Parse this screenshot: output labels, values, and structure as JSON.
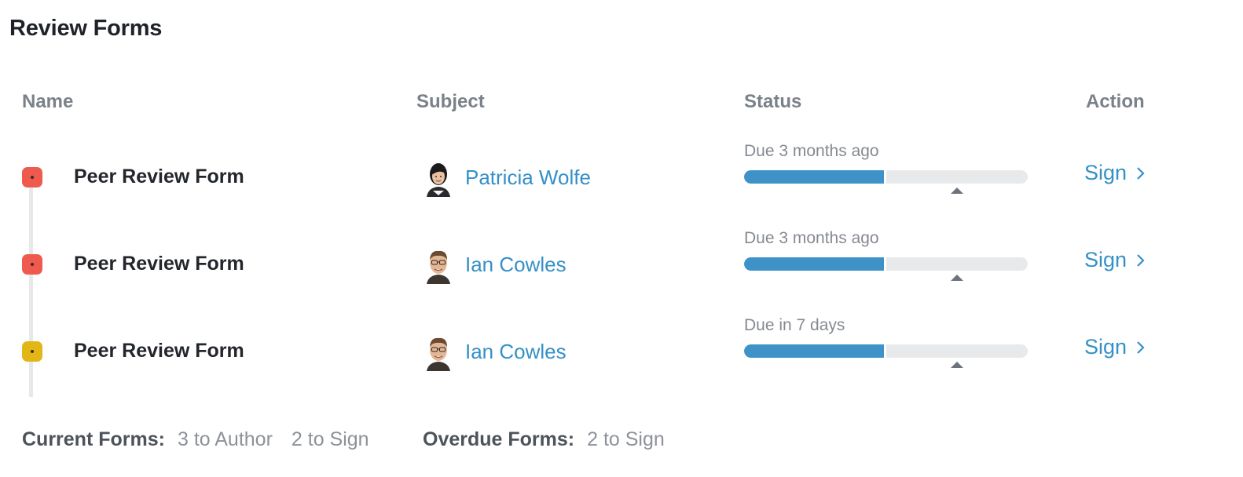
{
  "page": {
    "title": "Review Forms"
  },
  "columns": {
    "name": "Name",
    "subject": "Subject",
    "status": "Status",
    "action": "Action"
  },
  "rows": [
    {
      "status_color": "#ee5b4e",
      "form_name": "Peer Review Form",
      "subject": "Patricia Wolfe",
      "avatar": "woman-portrait-icon",
      "due": "Due 3 months ago",
      "progress_fraction": 0.5,
      "marker_fraction": 0.75,
      "action": "Sign"
    },
    {
      "status_color": "#ee5b4e",
      "form_name": "Peer Review Form",
      "subject": "Ian Cowles",
      "avatar": "man-portrait-icon",
      "due": "Due 3 months ago",
      "progress_fraction": 0.5,
      "marker_fraction": 0.75,
      "action": "Sign"
    },
    {
      "status_color": "#e2b614",
      "form_name": "Peer Review Form",
      "subject": "Ian Cowles",
      "avatar": "man-portrait-icon",
      "due": "Due in 7 days",
      "progress_fraction": 0.5,
      "marker_fraction": 0.75,
      "action": "Sign"
    }
  ],
  "footer": {
    "current_label": "Current Forms:",
    "current_author": "3 to Author",
    "current_sign": "2 to Sign",
    "overdue_label": "Overdue Forms:",
    "overdue_sign": "2 to Sign"
  },
  "colors": {
    "link": "#3490c7",
    "progress": "#3f92c8",
    "overdue": "#ee5b4e",
    "upcoming": "#e2b614"
  }
}
